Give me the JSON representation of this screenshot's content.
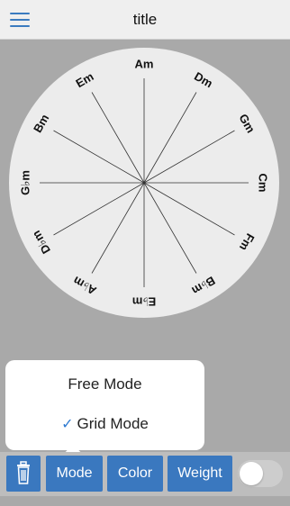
{
  "header": {
    "title": "title",
    "menu_icon": "hamburger-menu-icon"
  },
  "circle": {
    "labels": [
      "Am",
      "Dm",
      "Gm",
      "Cm",
      "Fm",
      "B♭m",
      "E♭m",
      "A♭m",
      "D♭m",
      "G♭m",
      "Bm",
      "Em"
    ],
    "colors": {
      "background": "#a9a9a9",
      "disc": "#ececec",
      "lines": "#333333"
    }
  },
  "popover": {
    "items": [
      {
        "label": "Free Mode",
        "selected": false
      },
      {
        "label": "Grid Mode",
        "selected": true
      }
    ],
    "check_icon": "checkmark-icon"
  },
  "toolbar": {
    "trash_icon": "trash-icon",
    "mode_label": "Mode",
    "color_label": "Color",
    "weight_label": "Weight",
    "toggle_on": false,
    "button_color": "#3a78bf"
  }
}
